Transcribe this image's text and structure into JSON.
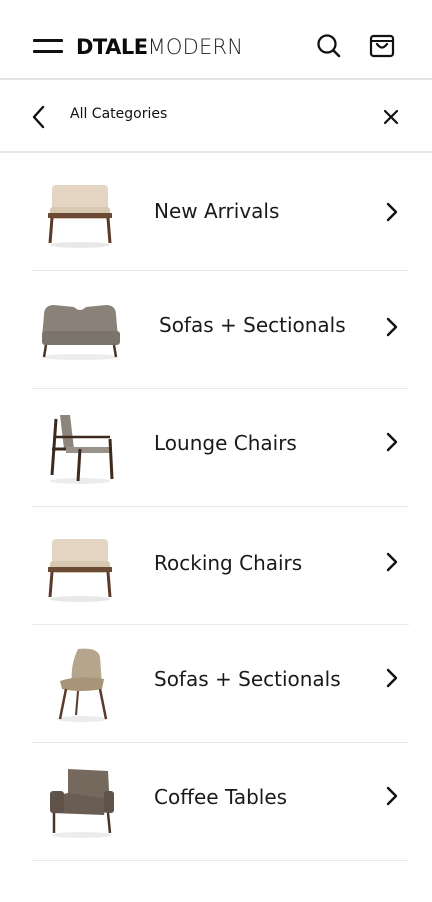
{
  "header": {
    "logo_bold": "DTALE",
    "logo_light": "MODERN",
    "menu_icon": "hamburger-menu-icon",
    "search_icon": "search-icon",
    "cart_icon": "shopping-bag-icon"
  },
  "subheader": {
    "title": "All Categories",
    "back_icon": "chevron-left-icon",
    "close_icon": "close-icon"
  },
  "categories": [
    {
      "label": "New Arrivals",
      "thumb": "armchair-beige"
    },
    {
      "label": "Sofas + Sectionals",
      "thumb": "sofa-grey"
    },
    {
      "label": "Lounge Chairs",
      "thumb": "lounge-chair-wood"
    },
    {
      "label": "Rocking Chairs",
      "thumb": "armchair-beige"
    },
    {
      "label": "Sofas + Sectionals",
      "thumb": "side-chair-tan"
    },
    {
      "label": "Coffee Tables",
      "thumb": "armchair-brown"
    }
  ],
  "colors": {
    "accent": "#f2b01e",
    "text": "#1a1a1a",
    "divider": "#e9e9e9"
  }
}
